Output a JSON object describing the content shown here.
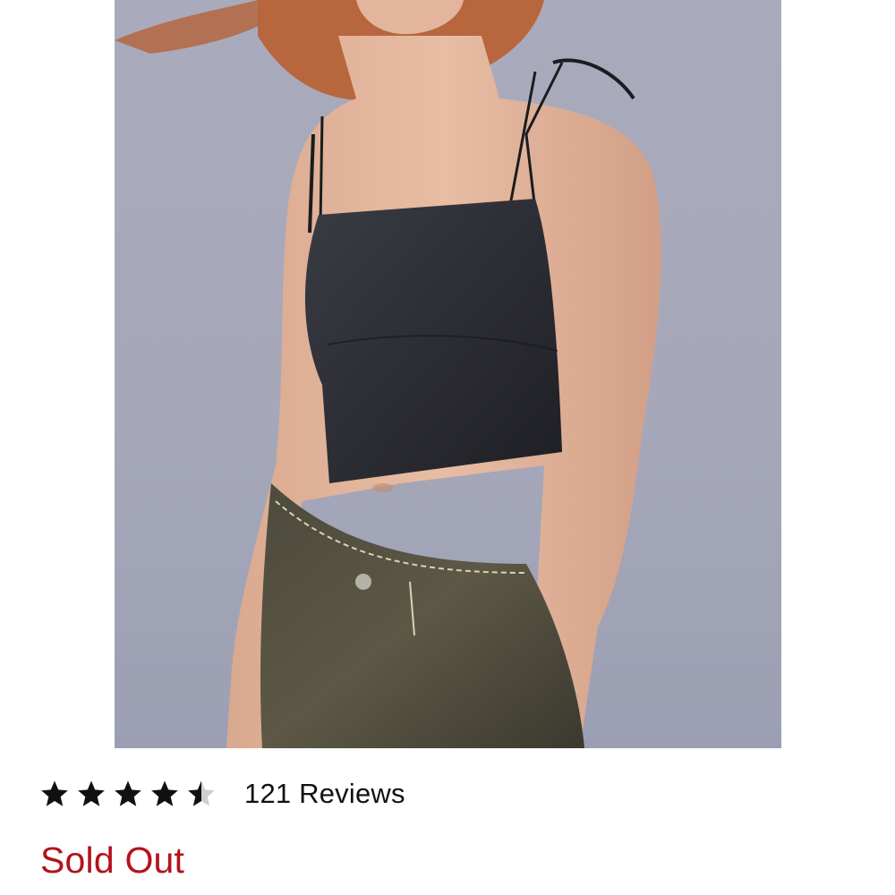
{
  "product": {
    "image_alt": "Model wearing black satin cropped cami top with tie straps and acid-wash jeans"
  },
  "rating": {
    "value": 4.5,
    "max": 5,
    "star_color": "#111111",
    "empty_star_color": "#cfcfcf",
    "reviews_text": "121 Reviews"
  },
  "availability": {
    "status_text": "Sold Out",
    "status_color": "#b5121b"
  }
}
